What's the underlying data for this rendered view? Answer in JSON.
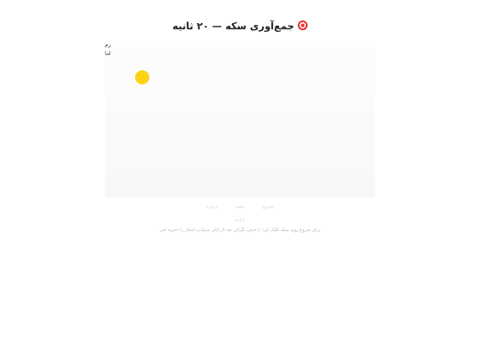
{
  "title": {
    "text": "جمع‌آوری سکه — ۲۰ ثانیه",
    "icon": "target-icon"
  },
  "hud": {
    "time": "زم",
    "score": "اما"
  },
  "game": {
    "coin_color": "#fbd314",
    "board_color": "#f9f9f9"
  },
  "controls": {
    "start": "شروع",
    "pause": "توقف",
    "restart": "دوباره"
  },
  "status": "آماده",
  "help": "برای شروع روی سکه کلیک کن؛ با حذف نگرانی بعد از پایان میتوانی امتیاز را ذخیره کنی"
}
